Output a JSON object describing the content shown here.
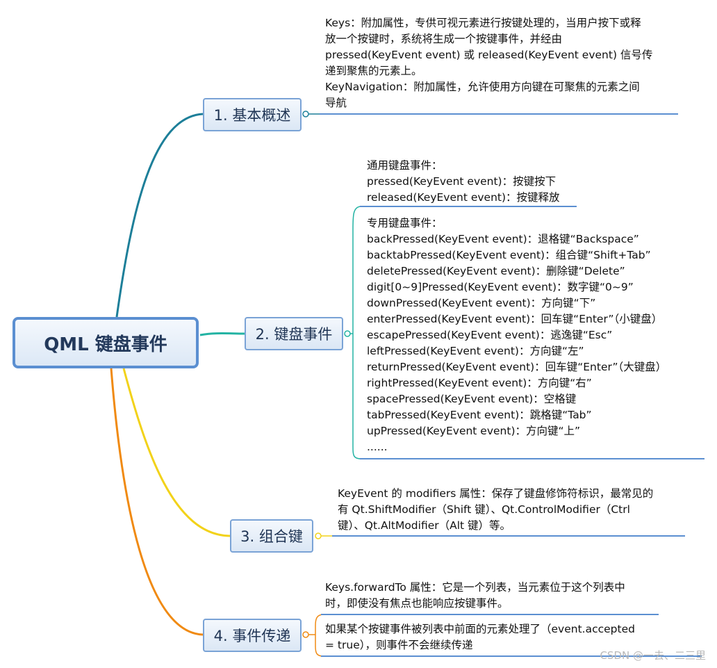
{
  "root": {
    "label": "QML 键盘事件"
  },
  "branches": [
    {
      "label": "1. 基本概述",
      "lines": [
        "Keys：附加属性，专供可视元素进行按键处理的，当用户按下或释",
        "放一个按键时，系统将生成一个按键事件，并经由",
        "pressed(KeyEvent event) 或 released(KeyEvent event) 信号传",
        "递到聚焦的元素上。",
        "KeyNavigation：附加属性，允许使用方向键在可聚焦的元素之间",
        "导航"
      ]
    },
    {
      "label": "2. 键盘事件",
      "general": [
        "通用键盘事件：",
        "pressed(KeyEvent event)：按键按下",
        "released(KeyEvent event)：按键释放"
      ],
      "special": [
        "专用键盘事件：",
        "backPressed(KeyEvent event)：退格键“Backspace”",
        "backtabPressed(KeyEvent event)：组合键“Shift+Tab”",
        "deletePressed(KeyEvent event)：删除键“Delete”",
        "digit[0~9]Pressed(KeyEvent event)：数字键“0~9”",
        "downPressed(KeyEvent event)：方向键“下”",
        "enterPressed(KeyEvent event)：回车键“Enter”（小键盘）",
        "escapePressed(KeyEvent event)：逃逸键“Esc”",
        "leftPressed(KeyEvent event)：方向键“左”",
        "returnPressed(KeyEvent event)：回车键“Enter”（大键盘）",
        "rightPressed(KeyEvent event)：方向键“右”",
        "spacePressed(KeyEvent event)：空格键",
        "tabPressed(KeyEvent event)：跳格键“Tab”",
        "upPressed(KeyEvent event)：方向键“上”",
        "......"
      ]
    },
    {
      "label": "3. 组合键",
      "lines": [
        "KeyEvent 的 modifiers 属性：保存了键盘修饰符标识，最常见的",
        "有 Qt.ShiftModifier（Shift 键）、Qt.ControlModifier（Ctrl",
        "键）、Qt.AltModifier（Alt 键）等。"
      ]
    },
    {
      "label": "4. 事件传递",
      "first": [
        "Keys.forwardTo 属性：它是一个列表，当元素位于这个列表中",
        "时，即使没有焦点也能响应按键事件。"
      ],
      "second": [
        "如果某个按键事件被列表中前面的元素处理了（event.accepted",
        "= true），则事件不会继续传递"
      ]
    }
  ],
  "colors": {
    "branch1": "#1d7f99",
    "branch2": "#23b3a3",
    "branch3": "#f2d21a",
    "branch4": "#f08a12",
    "underline": "#5b8fd1"
  },
  "watermark": "CSDN @一去、二三里"
}
